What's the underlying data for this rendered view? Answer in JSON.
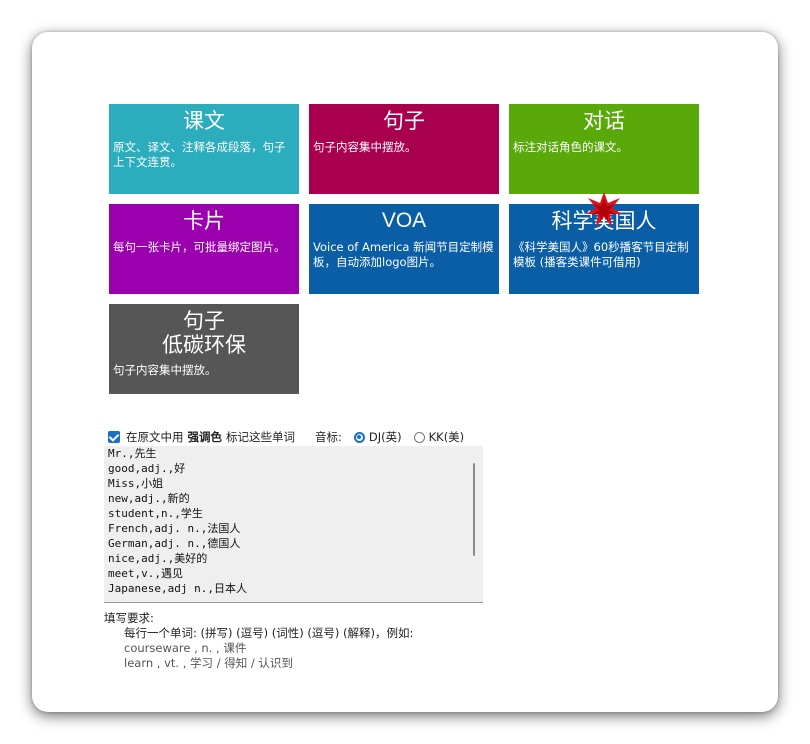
{
  "tiles": [
    {
      "title": "课文",
      "desc": "原文、译文、注释各成段落，句子上下文连贯。",
      "color": "#2cadbd"
    },
    {
      "title": "句子",
      "desc": "句子内容集中摆放。",
      "color": "#a8004e"
    },
    {
      "title": "对话",
      "desc": "标注对话角色的课文。",
      "color": "#5aa90a"
    },
    {
      "title": "卡片",
      "desc": "每句一张卡片，可批量绑定图片。",
      "color": "#9b00ae"
    },
    {
      "title": "VOA",
      "desc": "Voice of America 新闻节目定制模板，自动添加logo图片。",
      "color": "#0a5ea6"
    },
    {
      "title": "科学美国人",
      "desc": "《科学美国人》60秒播客节目定制模板 (播客类课件可借用)",
      "color": "#0a5ea6"
    },
    {
      "title": "句子\n低碳环保",
      "desc": "句子内容集中摆放。",
      "color": "#565656"
    }
  ],
  "options": {
    "highlight_prefix": "在原文中用",
    "highlight_bold": "强调色",
    "highlight_suffix": "标记这些单词",
    "highlight_checked": true,
    "phonetic_label": "音标:",
    "phonetic_options": [
      "DJ(英)",
      "KK(美)"
    ],
    "phonetic_selected": "DJ(英)"
  },
  "word_list": [
    "Mr.,先生",
    "good,adj.,好",
    "Miss,小姐",
    "new,adj.,新的",
    "student,n.,学生",
    "French,adj. n.,法国人",
    "German,adj. n.,德国人",
    "nice,adj.,美好的",
    "meet,v.,遇见",
    "Japanese,adj n.,日本人"
  ],
  "help": {
    "title": "填写要求:",
    "rule": "每行一个单词: (拼写) (逗号) (词性) (逗号) (解释)，例如:",
    "example1": "courseware , n. , 课件",
    "example2": "learn , vt. , 学习 / 得知 / 认识到"
  },
  "colors": {
    "accent": "#1a6fc4",
    "burst": "#e0101a"
  }
}
